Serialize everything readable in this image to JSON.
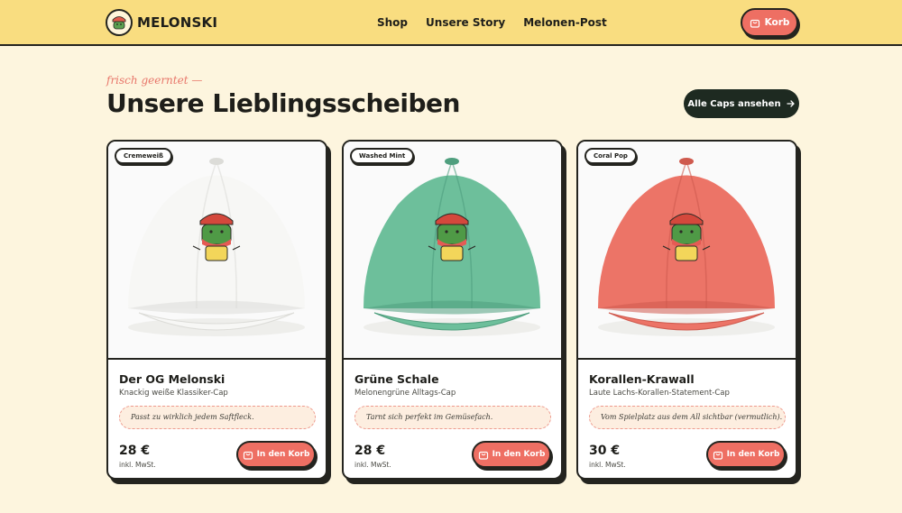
{
  "header": {
    "brand": "MELONSKI",
    "nav": [
      "Shop",
      "Unsere Story",
      "Melonen-Post"
    ],
    "cart_label": "Korb"
  },
  "section": {
    "eyebrow": "frisch geerntet —",
    "title": "Unsere Lieblingsscheiben",
    "all_button": "Alle Caps ansehen"
  },
  "products": [
    {
      "tag": "Cremeweiß",
      "name": "Der OG Melonski",
      "subtitle": "Knackig weiße Klassiker-Cap",
      "quote": "Passt zu wirklich jedem Saftfleck.",
      "price": "28 €",
      "tax": "inkl. MwSt.",
      "button": "In den Korb",
      "cap_color": "#f7f7f5",
      "cap_shade": "#dcdcd8"
    },
    {
      "tag": "Washed Mint",
      "name": "Grüne Schale",
      "subtitle": "Melonengrüne Alltags-Cap",
      "quote": "Tarnt sich perfekt im Gemüsefach.",
      "price": "28 €",
      "tax": "inkl. MwSt.",
      "button": "In den Korb",
      "cap_color": "#6dbf9b",
      "cap_shade": "#4f9f7e"
    },
    {
      "tag": "Coral Pop",
      "name": "Korallen-Krawall",
      "subtitle": "Laute Lachs-Korallen-Statement-Cap",
      "quote": "Vom Spielplatz aus dem All sichtbar (vermutlich).",
      "price": "30 €",
      "tax": "inkl. MwSt.",
      "button": "In den Korb",
      "cap_color": "#ec7467",
      "cap_shade": "#cf5a4e"
    }
  ],
  "colors": {
    "header_bg": "#f9dd80",
    "page_bg": "#fdf5de",
    "accent": "#ee6f63",
    "dark": "#1e2a21"
  },
  "icons": {
    "cart": "shopping-bag-icon",
    "arrow": "arrow-right-icon",
    "logo": "melon-mascot-icon"
  }
}
